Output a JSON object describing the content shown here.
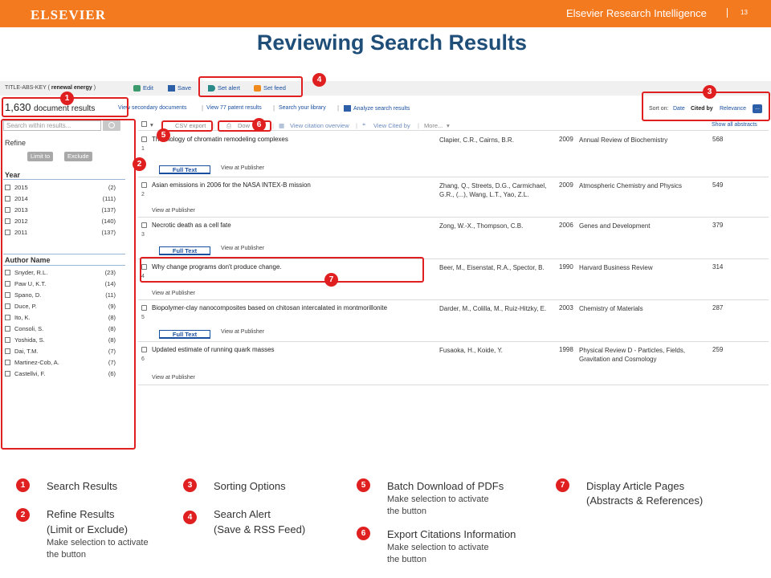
{
  "header": {
    "logo": "ELSEVIER",
    "brand": "Elsevier Research Intelligence",
    "page_number": "13",
    "title": "Reviewing Search Results"
  },
  "colors": {
    "accent": "#f47a20",
    "title": "#1f4e79",
    "highlight": "#e02020",
    "link": "#1a4fa0"
  },
  "query": {
    "field": "TITLE-ABS-KEY",
    "open": "(",
    "term": "renewal energy",
    "close": ")"
  },
  "query_actions": {
    "edit": "Edit",
    "save": "Save",
    "set_alert": "Set alert",
    "set_feed": "Set feed",
    "edit_icon": "arrow-icon",
    "save_icon": "disk-icon",
    "alert_icon": "tag-icon",
    "feed_icon": "rss-icon"
  },
  "results_header": {
    "count": "1,630",
    "count_label": "document results",
    "links": [
      "View secondary documents",
      "View 77 patent results",
      "Search your library",
      "Analyze search results"
    ],
    "sort_label": "Sort on:",
    "sort_options": [
      "Date",
      "Cited by",
      "Relevance"
    ],
    "more_button": "..."
  },
  "sidebar": {
    "search_placeholder": "Search within results...",
    "refine_label": "Refine",
    "limit_to": "Limit to",
    "exclude": "Exclude",
    "year_title": "Year",
    "years": [
      {
        "label": "2015",
        "count": "(2)"
      },
      {
        "label": "2014",
        "count": "(111)"
      },
      {
        "label": "2013",
        "count": "(137)"
      },
      {
        "label": "2012",
        "count": "(140)"
      },
      {
        "label": "2011",
        "count": "(137)"
      }
    ],
    "author_title": "Author Name",
    "authors": [
      {
        "label": "Snyder, R.L.",
        "count": "(23)"
      },
      {
        "label": "Paw U, K.T.",
        "count": "(14)"
      },
      {
        "label": "Spano, D.",
        "count": "(11)"
      },
      {
        "label": "Duce, P.",
        "count": "(9)"
      },
      {
        "label": "Ito, K.",
        "count": "(8)"
      },
      {
        "label": "Consoli, S.",
        "count": "(8)"
      },
      {
        "label": "Yoshida, S.",
        "count": "(8)"
      },
      {
        "label": "Dai, T.M.",
        "count": "(7)"
      },
      {
        "label": "Martinez-Cob, A.",
        "count": "(7)"
      },
      {
        "label": "Castellvi, F.",
        "count": "(6)"
      }
    ]
  },
  "toolbar": {
    "csv_export": "CSV export",
    "download": "Dow",
    "view_citation": "View citation overview",
    "view_cited_by": "View Cited by",
    "more": "More...",
    "show_all_abstracts": "Show all abstracts"
  },
  "results": [
    {
      "num": "1",
      "title": "The biology of chromatin remodeling complexes",
      "authors": "Clapier, C.R., Cairns, B.R.",
      "year": "2009",
      "source": "Annual Review of Biochemistry",
      "cited": "568",
      "full_text": "Full Text",
      "view_at_publisher": "View at Publisher"
    },
    {
      "num": "2",
      "title": "Asian emissions in 2006 for the NASA INTEX-B mission",
      "authors": "Zhang, Q., Streets, D.G., Carmichael, G.R., (...), Wang, L.T., Yao, Z.L.",
      "year": "2009",
      "source": "Atmospheric Chemistry and Physics",
      "cited": "549",
      "full_text": "",
      "view_at_publisher": "View at Publisher"
    },
    {
      "num": "3",
      "title": "Necrotic death as a cell fate",
      "authors": "Zong, W.-X., Thompson, C.B.",
      "year": "2006",
      "source": "Genes and Development",
      "cited": "379",
      "full_text": "Full Text",
      "view_at_publisher": "View at Publisher"
    },
    {
      "num": "4",
      "title": "Why change programs don't produce change.",
      "authors": "Beer, M., Eisenstat, R.A., Spector, B.",
      "year": "1990",
      "source": "Harvard Business Review",
      "cited": "314",
      "full_text": "",
      "view_at_publisher": "View at Publisher"
    },
    {
      "num": "5",
      "title": "Biopolymer-clay nanocomposites based on chitosan intercalated in montmorillonite",
      "authors": "Darder, M., Colilla, M., Ruiz-Hitzky, E.",
      "year": "2003",
      "source": "Chemistry of Materials",
      "cited": "287",
      "full_text": "Full Text",
      "view_at_publisher": "View at Publisher"
    },
    {
      "num": "6",
      "title": "Updated estimate of running quark masses",
      "authors": "Fusaoka, H., Koide, Y.",
      "year": "1998",
      "source": "Physical Review D - Particles, Fields, Gravitation and Cosmology",
      "cited": "259",
      "full_text": "",
      "view_at_publisher": "View at Publisher"
    }
  ],
  "badges": [
    "1",
    "2",
    "3",
    "4",
    "5",
    "6",
    "7"
  ],
  "legend": {
    "l1": "Search Results",
    "l2_title": "Refine Results",
    "l2_sub1": "(Limit or Exclude)",
    "l2_note1": "Make selection to activate",
    "l2_note2": "the button",
    "l3": "Sorting Options",
    "l4_title": "Search Alert",
    "l4_sub": "(Save & RSS Feed)",
    "l5_title": "Batch Download of PDFs",
    "l5_note1": "Make selection to activate",
    "l5_note2": "the button",
    "l6_title": "Export Citations Information",
    "l6_note1": "Make selection to activate",
    "l6_note2": "the button",
    "l7_title": "Display Article Pages",
    "l7_sub": "(Abstracts & References)"
  }
}
